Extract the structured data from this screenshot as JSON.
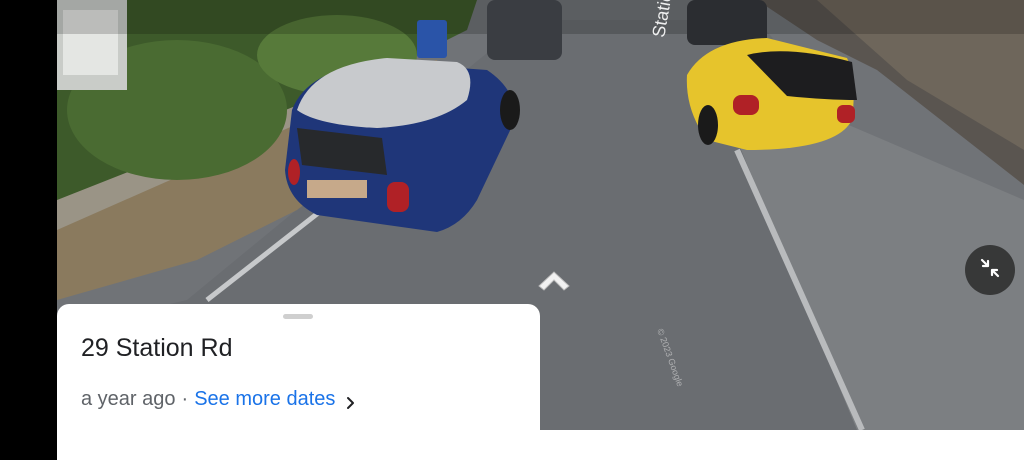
{
  "location": {
    "address": "29 Station Rd",
    "captured_ago": "a year ago",
    "separator": "·",
    "see_more_dates_label": "See more dates"
  },
  "scene": {
    "street_sign_text": "Station",
    "watermark": "© 2023 Google"
  },
  "icons": {
    "collapse": "collapse-arrows-icon",
    "navigate": "navigate-forward-chevron-icon",
    "dates": "chevron-right-icon"
  },
  "colors": {
    "link": "#1a73e8",
    "card_bg": "#ffffff",
    "title_text": "#202124",
    "meta_text": "#5f6368"
  }
}
